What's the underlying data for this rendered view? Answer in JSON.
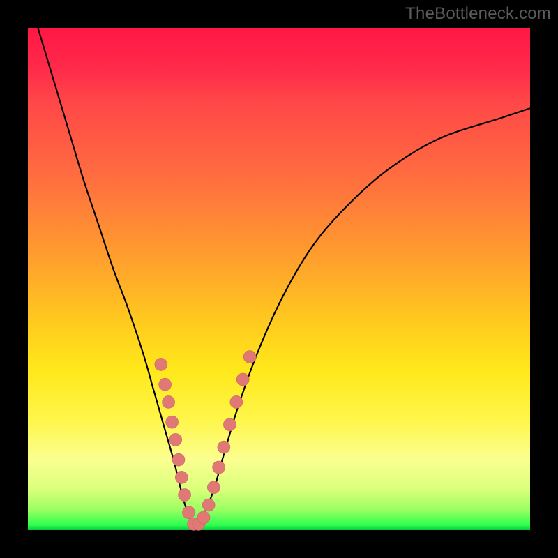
{
  "watermark": "TheBottleneck.com",
  "colors": {
    "curve": "#000000",
    "marker_fill": "#e07876",
    "marker_stroke": "#d06462"
  },
  "chart_data": {
    "type": "line",
    "title": "",
    "xlabel": "",
    "ylabel": "",
    "xlim": [
      0,
      100
    ],
    "ylim": [
      0,
      100
    ],
    "curve": {
      "x": [
        2,
        5,
        8,
        11,
        14,
        17,
        20,
        23,
        25,
        27,
        29,
        30,
        31,
        32,
        33,
        34,
        35,
        37,
        39,
        42,
        46,
        51,
        57,
        64,
        72,
        82,
        94,
        100
      ],
      "y": [
        100,
        90,
        80,
        70,
        61,
        52,
        44,
        35,
        28,
        21,
        14,
        10,
        6,
        3,
        1,
        1,
        3,
        8,
        15,
        25,
        36,
        47,
        57,
        65,
        72,
        78,
        82,
        84
      ]
    },
    "markers": [
      {
        "x": 26.5,
        "y": 33
      },
      {
        "x": 27.3,
        "y": 29
      },
      {
        "x": 28.0,
        "y": 25.5
      },
      {
        "x": 28.7,
        "y": 21.5
      },
      {
        "x": 29.4,
        "y": 18
      },
      {
        "x": 30.0,
        "y": 14
      },
      {
        "x": 30.6,
        "y": 10.5
      },
      {
        "x": 31.2,
        "y": 7
      },
      {
        "x": 32.0,
        "y": 3.5
      },
      {
        "x": 33.0,
        "y": 1.2
      },
      {
        "x": 34.0,
        "y": 1.2
      },
      {
        "x": 35.0,
        "y": 2.5
      },
      {
        "x": 36.0,
        "y": 5
      },
      {
        "x": 37.0,
        "y": 8.5
      },
      {
        "x": 38.0,
        "y": 12.5
      },
      {
        "x": 39.0,
        "y": 16.5
      },
      {
        "x": 40.2,
        "y": 21
      },
      {
        "x": 41.5,
        "y": 25.5
      },
      {
        "x": 42.8,
        "y": 30
      },
      {
        "x": 44.2,
        "y": 34.5
      }
    ],
    "marker_radius_px": 9
  }
}
